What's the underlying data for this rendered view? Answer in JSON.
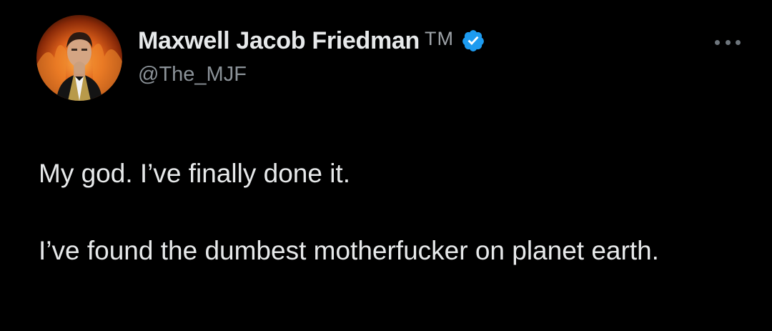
{
  "author": {
    "display_name": "Maxwell Jacob Friedman",
    "name_suffix": "TM",
    "handle": "@The_MJF",
    "verified": true,
    "verified_color": "#1d9bf0",
    "avatar_icon": "profile-photo"
  },
  "tweet": {
    "paragraphs": [
      "My god. I’ve finally done it.",
      "I’ve found the dumbest motherfucker on planet earth."
    ]
  },
  "menu": {
    "icon": "more-options-icon"
  },
  "colors": {
    "background": "#000000",
    "text": "#e7e9ea",
    "secondary": "#8b9298"
  }
}
